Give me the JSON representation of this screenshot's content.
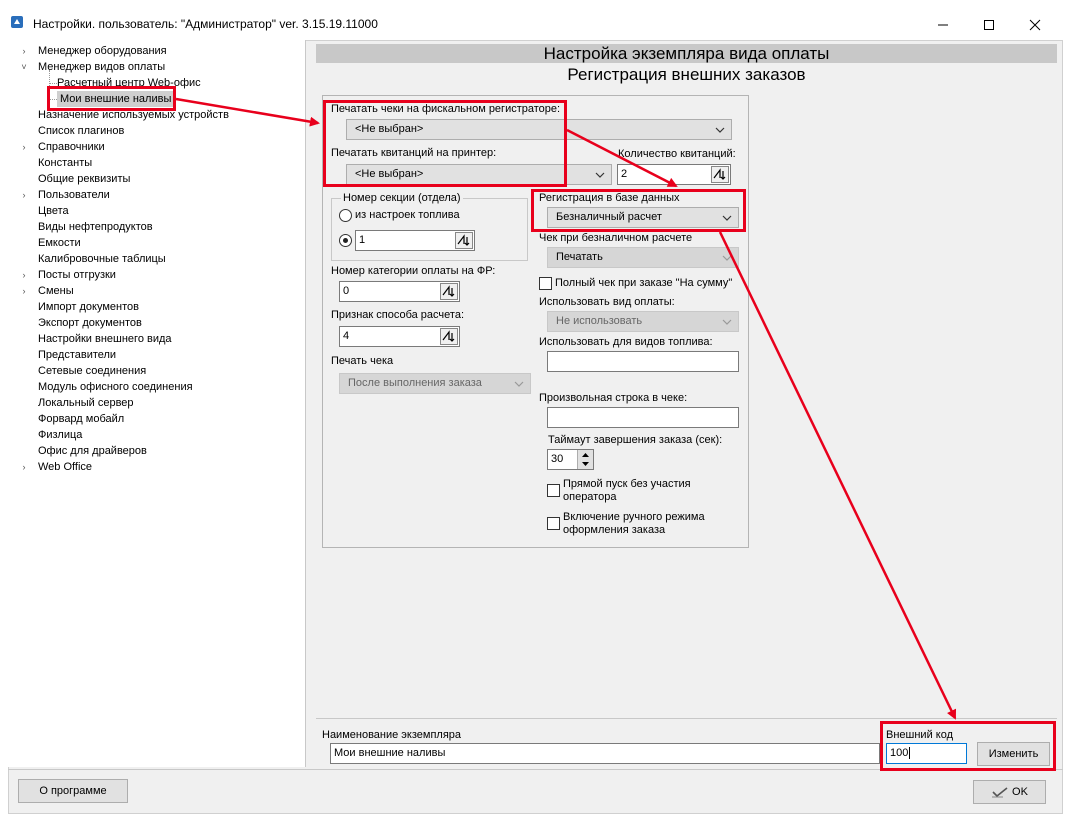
{
  "window": {
    "title": "Настройки. пользователь: \"Администратор\" ver. 3.15.19.11000"
  },
  "tree": {
    "items": [
      {
        "label": "Менеджер оборудования",
        "arrow": "›"
      },
      {
        "label": "Менеджер видов оплаты",
        "arrow": "˅"
      },
      {
        "label": "Расчетный центр Web-офис",
        "arrow": ""
      },
      {
        "label": "Мои внешние наливы",
        "arrow": ""
      },
      {
        "label": "Назначение используемых устройств",
        "arrow": ""
      },
      {
        "label": "Список плагинов",
        "arrow": ""
      },
      {
        "label": "Справочники",
        "arrow": "›"
      },
      {
        "label": "Константы",
        "arrow": ""
      },
      {
        "label": "Общие реквизиты",
        "arrow": ""
      },
      {
        "label": "Пользователи",
        "arrow": "›"
      },
      {
        "label": "Цвета",
        "arrow": ""
      },
      {
        "label": "Виды нефтепродуктов",
        "arrow": ""
      },
      {
        "label": "Емкости",
        "arrow": ""
      },
      {
        "label": "Калибровочные таблицы",
        "arrow": ""
      },
      {
        "label": "Посты отгрузки",
        "arrow": "›"
      },
      {
        "label": "Смены",
        "arrow": "›"
      },
      {
        "label": "Импорт документов",
        "arrow": ""
      },
      {
        "label": "Экспорт документов",
        "arrow": ""
      },
      {
        "label": "Настройки внешнего вида",
        "arrow": ""
      },
      {
        "label": "Представители",
        "arrow": ""
      },
      {
        "label": "Сетевые соединения",
        "arrow": ""
      },
      {
        "label": "Модуль офисного соединения",
        "arrow": ""
      },
      {
        "label": "Локальный сервер",
        "arrow": ""
      },
      {
        "label": "Форвард мобайл",
        "arrow": ""
      },
      {
        "label": "Физлица",
        "arrow": ""
      },
      {
        "label": "Офис для драйверов",
        "arrow": ""
      },
      {
        "label": "Web Office",
        "arrow": "›"
      }
    ]
  },
  "header": {
    "title": "Настройка экземпляра вида оплаты",
    "subtitle": "Регистрация внешних заказов"
  },
  "form": {
    "fiscal_label": "Печатать чеки на фискальном регистраторе:",
    "fiscal_value": "<Не выбран>",
    "printer_label": "Печатать квитанций на принтер:",
    "printer_value": "<Не выбран>",
    "receipts_count_label": "Количество квитанций:",
    "receipts_count_value": "2",
    "section_group_label": "Номер секции (отдела)",
    "section_radio1_label": "из настроек топлива",
    "section_value": "1",
    "pay_category_label": "Номер категории оплаты на ФР:",
    "pay_category_value": "0",
    "pay_method_label": "Признак способа расчета:",
    "pay_method_value": "4",
    "print_check_label": "Печать чека",
    "print_check_value": "После выполнения заказа",
    "db_reg_label": "Регистрация в базе данных",
    "db_reg_value": "Безналичный расчет",
    "cashless_check_label": "Чек при безналичном расчете",
    "cashless_check_value": "Печатать",
    "full_check_label": "Полный чек при заказе \"На сумму\"",
    "use_pay_type_label": "Использовать вид оплаты:",
    "use_pay_type_value": "Не использовать",
    "use_fuel_label": "Использовать для видов топлива:",
    "use_fuel_value": "",
    "custom_line_label": "Произвольная строка в чеке:",
    "custom_line_value": "",
    "timeout_label": "Таймаут завершения заказа (сек):",
    "timeout_value": "30",
    "direct_start_label_1": "Прямой пуск без участия",
    "direct_start_label_2": "оператора",
    "manual_mode_label_1": "Включение ручного режима",
    "manual_mode_label_2": "оформления заказа"
  },
  "bottom": {
    "name_label": "Наименование экземпляра",
    "name_value": "Мои внешние наливы",
    "ext_code_label": "Внешний код",
    "ext_code_value": "100",
    "change_button": "Изменить"
  },
  "footer": {
    "about_button": "О программе",
    "ok_button": "OK"
  },
  "colors": {
    "annotation": "#e8001c",
    "header_bg": "#c8c8c8",
    "panel_bg": "#f0f0f0"
  }
}
